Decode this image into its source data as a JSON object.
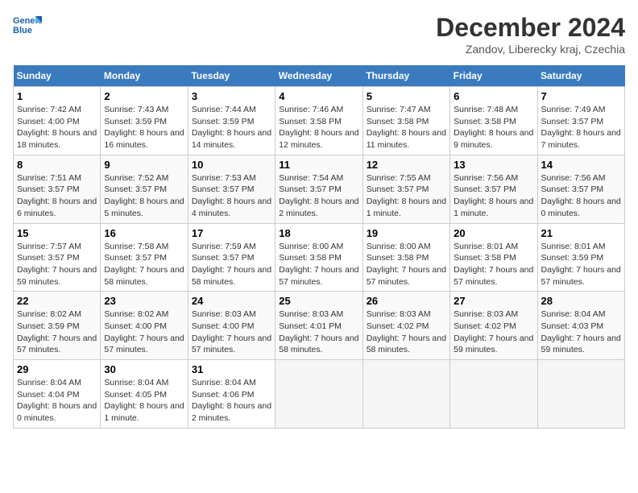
{
  "header": {
    "logo_line1": "General",
    "logo_line2": "Blue",
    "month_title": "December 2024",
    "subtitle": "Zandov, Liberecky kraj, Czechia"
  },
  "weekdays": [
    "Sunday",
    "Monday",
    "Tuesday",
    "Wednesday",
    "Thursday",
    "Friday",
    "Saturday"
  ],
  "weeks": [
    [
      {
        "day": "1",
        "info": "Sunrise: 7:42 AM\nSunset: 4:00 PM\nDaylight: 8 hours and 18 minutes."
      },
      {
        "day": "2",
        "info": "Sunrise: 7:43 AM\nSunset: 3:59 PM\nDaylight: 8 hours and 16 minutes."
      },
      {
        "day": "3",
        "info": "Sunrise: 7:44 AM\nSunset: 3:59 PM\nDaylight: 8 hours and 14 minutes."
      },
      {
        "day": "4",
        "info": "Sunrise: 7:46 AM\nSunset: 3:58 PM\nDaylight: 8 hours and 12 minutes."
      },
      {
        "day": "5",
        "info": "Sunrise: 7:47 AM\nSunset: 3:58 PM\nDaylight: 8 hours and 11 minutes."
      },
      {
        "day": "6",
        "info": "Sunrise: 7:48 AM\nSunset: 3:58 PM\nDaylight: 8 hours and 9 minutes."
      },
      {
        "day": "7",
        "info": "Sunrise: 7:49 AM\nSunset: 3:57 PM\nDaylight: 8 hours and 7 minutes."
      }
    ],
    [
      {
        "day": "8",
        "info": "Sunrise: 7:51 AM\nSunset: 3:57 PM\nDaylight: 8 hours and 6 minutes."
      },
      {
        "day": "9",
        "info": "Sunrise: 7:52 AM\nSunset: 3:57 PM\nDaylight: 8 hours and 5 minutes."
      },
      {
        "day": "10",
        "info": "Sunrise: 7:53 AM\nSunset: 3:57 PM\nDaylight: 8 hours and 4 minutes."
      },
      {
        "day": "11",
        "info": "Sunrise: 7:54 AM\nSunset: 3:57 PM\nDaylight: 8 hours and 2 minutes."
      },
      {
        "day": "12",
        "info": "Sunrise: 7:55 AM\nSunset: 3:57 PM\nDaylight: 8 hours and 1 minute."
      },
      {
        "day": "13",
        "info": "Sunrise: 7:56 AM\nSunset: 3:57 PM\nDaylight: 8 hours and 1 minute."
      },
      {
        "day": "14",
        "info": "Sunrise: 7:56 AM\nSunset: 3:57 PM\nDaylight: 8 hours and 0 minutes."
      }
    ],
    [
      {
        "day": "15",
        "info": "Sunrise: 7:57 AM\nSunset: 3:57 PM\nDaylight: 7 hours and 59 minutes."
      },
      {
        "day": "16",
        "info": "Sunrise: 7:58 AM\nSunset: 3:57 PM\nDaylight: 7 hours and 58 minutes."
      },
      {
        "day": "17",
        "info": "Sunrise: 7:59 AM\nSunset: 3:57 PM\nDaylight: 7 hours and 58 minutes."
      },
      {
        "day": "18",
        "info": "Sunrise: 8:00 AM\nSunset: 3:58 PM\nDaylight: 7 hours and 57 minutes."
      },
      {
        "day": "19",
        "info": "Sunrise: 8:00 AM\nSunset: 3:58 PM\nDaylight: 7 hours and 57 minutes."
      },
      {
        "day": "20",
        "info": "Sunrise: 8:01 AM\nSunset: 3:58 PM\nDaylight: 7 hours and 57 minutes."
      },
      {
        "day": "21",
        "info": "Sunrise: 8:01 AM\nSunset: 3:59 PM\nDaylight: 7 hours and 57 minutes."
      }
    ],
    [
      {
        "day": "22",
        "info": "Sunrise: 8:02 AM\nSunset: 3:59 PM\nDaylight: 7 hours and 57 minutes."
      },
      {
        "day": "23",
        "info": "Sunrise: 8:02 AM\nSunset: 4:00 PM\nDaylight: 7 hours and 57 minutes."
      },
      {
        "day": "24",
        "info": "Sunrise: 8:03 AM\nSunset: 4:00 PM\nDaylight: 7 hours and 57 minutes."
      },
      {
        "day": "25",
        "info": "Sunrise: 8:03 AM\nSunset: 4:01 PM\nDaylight: 7 hours and 58 minutes."
      },
      {
        "day": "26",
        "info": "Sunrise: 8:03 AM\nSunset: 4:02 PM\nDaylight: 7 hours and 58 minutes."
      },
      {
        "day": "27",
        "info": "Sunrise: 8:03 AM\nSunset: 4:02 PM\nDaylight: 7 hours and 59 minutes."
      },
      {
        "day": "28",
        "info": "Sunrise: 8:04 AM\nSunset: 4:03 PM\nDaylight: 7 hours and 59 minutes."
      }
    ],
    [
      {
        "day": "29",
        "info": "Sunrise: 8:04 AM\nSunset: 4:04 PM\nDaylight: 8 hours and 0 minutes."
      },
      {
        "day": "30",
        "info": "Sunrise: 8:04 AM\nSunset: 4:05 PM\nDaylight: 8 hours and 1 minute."
      },
      {
        "day": "31",
        "info": "Sunrise: 8:04 AM\nSunset: 4:06 PM\nDaylight: 8 hours and 2 minutes."
      },
      null,
      null,
      null,
      null
    ]
  ]
}
